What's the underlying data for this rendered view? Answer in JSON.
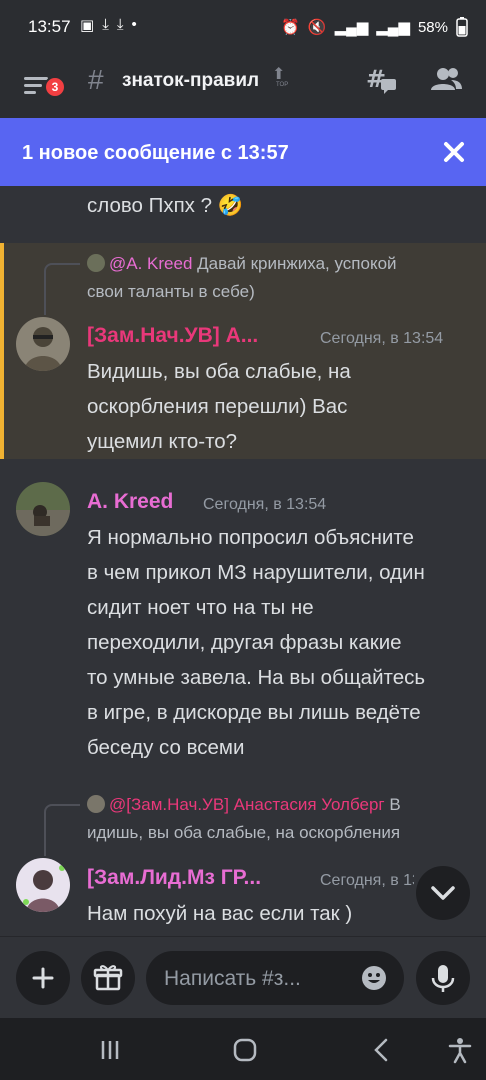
{
  "status_bar": {
    "time": "13:57",
    "battery": "58%"
  },
  "header": {
    "channel_name": "знаток-правил",
    "top_label": "TOP",
    "menu_badge": "3"
  },
  "new_messages_bar": {
    "text": "1 новое сообщение с 13:57"
  },
  "messages": [
    {
      "type": "fragment",
      "text": "слово Пхпх ? 🤣"
    },
    {
      "reply_to": {
        "author": "@A. Kreed",
        "text_line1": "Давай кринжиха, успокой",
        "text_line2": "свои таланты в себе)"
      },
      "author": "[Зам.Нач.УВ] А...",
      "timestamp": "Сегодня, в 13:54",
      "lines": [
        "Видишь, вы оба слабые, на",
        "оскорбления перешли) Вас",
        "ущемил кто-то?"
      ]
    },
    {
      "author": "A. Kreed",
      "timestamp": "Сегодня, в 13:54",
      "lines": [
        "Я нормально попросил объясните",
        "в чем прикол МЗ нарушители, один",
        "сидит ноет что на ты не",
        "переходили, другая фразы какие",
        "то умные завела. На вы общайтесь",
        "в игре, в дискорде вы лишь ведёте",
        "беседу со всеми"
      ]
    },
    {
      "reply_to": {
        "author": "@[Зам.Нач.УВ] Анастасия Уолберг",
        "text_line1": "В",
        "text_line2": "идишь, вы оба слабые, на оскорбления"
      },
      "author": "[Зам.Лид.Мз ГР...",
      "timestamp": "Сегодня, в 13:5",
      "lines": [
        "Нам похуй на вас если так )"
      ]
    }
  ],
  "composer": {
    "placeholder": "Написать #з..."
  },
  "colors": {
    "accent": "#5865f2",
    "mention_highlight": "#3f3c36",
    "mention_border": "#f0b232",
    "author_pink": "#e86dd3",
    "author_red": "#e9387a",
    "badge": "#f23f42"
  }
}
